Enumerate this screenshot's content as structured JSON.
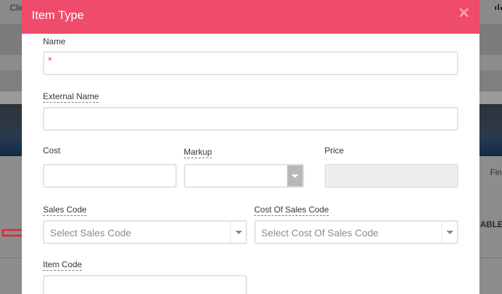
{
  "background": {
    "top_left_text": "Clie",
    "right_text_1": "Fin",
    "right_text_2": "ABLE"
  },
  "modal": {
    "title": "Item Type",
    "close_icon": "close-icon",
    "header_color": "#ef4b6b",
    "fields": {
      "name": {
        "label": "Name",
        "value": "",
        "required_marker": "*"
      },
      "external_name": {
        "label": "External Name",
        "value": ""
      },
      "cost": {
        "label": "Cost",
        "value": ""
      },
      "markup": {
        "label": "Markup",
        "value": ""
      },
      "price": {
        "label": "Price",
        "value": ""
      },
      "sales_code": {
        "label": "Sales Code",
        "placeholder": "Select Sales Code"
      },
      "cost_of_sales_code": {
        "label": "Cost Of Sales Code",
        "placeholder": "Select Cost Of Sales Code"
      },
      "item_code": {
        "label": "Item Code",
        "value": ""
      }
    }
  },
  "annotation": {
    "arrow_color": "#e8232a",
    "arrow_icon": "arrow-right-icon"
  }
}
